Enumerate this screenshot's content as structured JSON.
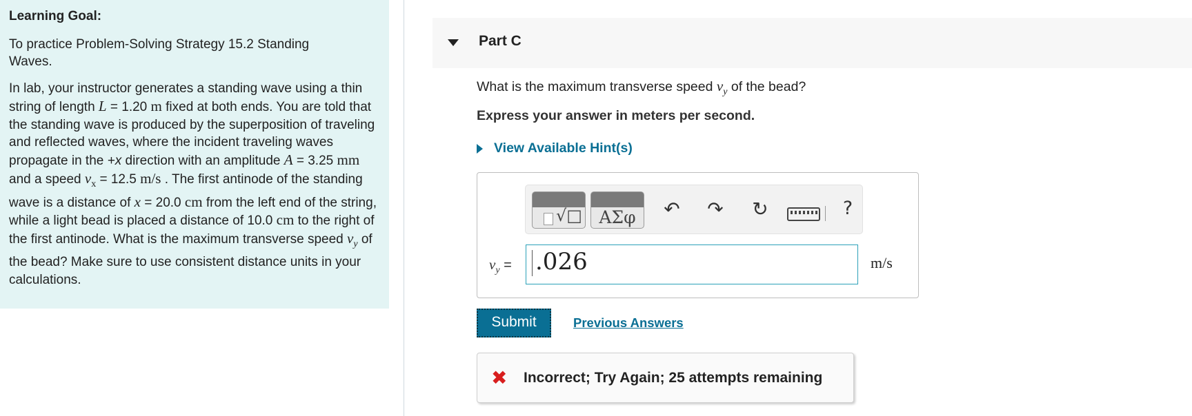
{
  "learning_goal": {
    "title": "Learning Goal:",
    "strategy": "To practice Problem-Solving Strategy 15.2 Standing Waves.",
    "body": {
      "p1": "In lab, your instructor generates a standing wave using a thin string of length ",
      "L_var": "L",
      "L_eq": " = 1.20 ",
      "L_unit": "m",
      "p2": " fixed at both ends. You are told that the standing wave is produced by the superposition of traveling and reflected waves, where the incident traveling waves propagate in the ",
      "dir": "+x",
      "p3": " direction with an amplitude ",
      "A_var": "A",
      "A_eq": " = 3.25 ",
      "A_unit": "mm",
      "p4": " and a speed ",
      "v_var": "v",
      "v_sub": "x",
      "v_eq": " = 12.5 ",
      "v_unit": "m/s",
      "p5": " . The first antinode of the standing wave is a distance of ",
      "x_var": "x",
      "x_eq": " = 20.0 ",
      "x_unit": "cm",
      "p6": " from the left end of the string, while a light bead is placed a distance of 10.0 ",
      "bead_unit": "cm",
      "p7": " to the right of the first antinode. What is the maximum transverse speed ",
      "vy_var": "v",
      "vy_sub": "y",
      "p8": " of the bead? Make sure to use consistent distance units in your calculations."
    }
  },
  "part": {
    "title": "Part C",
    "question_pre": "What is the maximum transverse speed ",
    "question_var": "v",
    "question_sub": "y",
    "question_post": " of the bead?",
    "instruction": "Express your answer in meters per second.",
    "hint_label": "View Available Hint(s)"
  },
  "answer": {
    "toolbar": {
      "template_icon": "template-radical-icon",
      "greek_label": "ΑΣφ",
      "undo_glyph": "↶",
      "redo_glyph": "↷",
      "reset_glyph": "↻",
      "help_glyph": "?"
    },
    "variable": "v",
    "variable_sub": "y",
    "equals": " =",
    "value": ".026",
    "unit": "m/s"
  },
  "actions": {
    "submit_label": "Submit",
    "previous_answers_label": "Previous Answers"
  },
  "feedback": {
    "icon": "✖",
    "text": "Incorrect; Try Again; 25 attempts remaining",
    "color": "#d81e1e"
  },
  "colors": {
    "accent": "#0a6f94",
    "left_panel_bg": "#e3f4f4",
    "header_bg": "#f7f7f7"
  }
}
